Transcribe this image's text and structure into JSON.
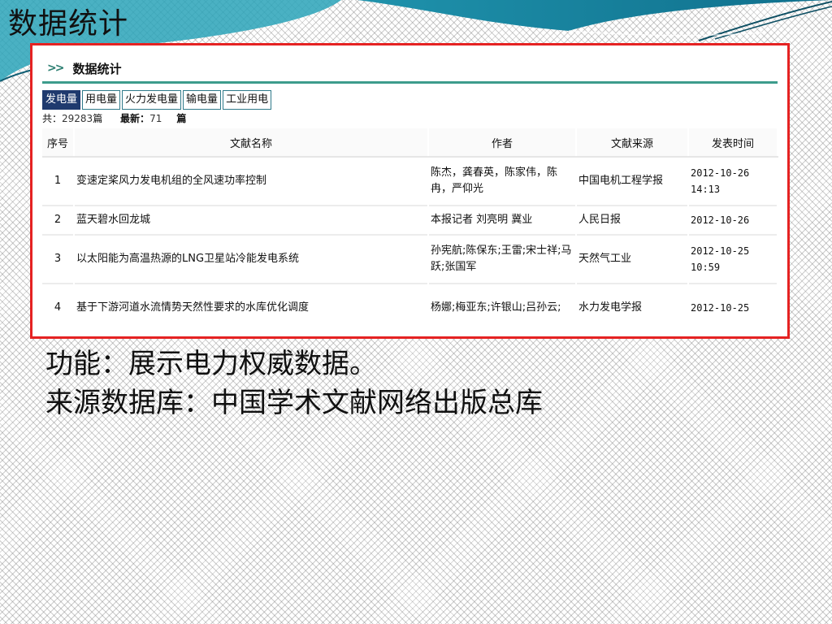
{
  "slide": {
    "title": "数据统计",
    "caption_function": "功能：展示电力权威数据。",
    "caption_source": "来源数据库：中国学术文献网络出版总库"
  },
  "panel": {
    "chevron": ">>",
    "title": "数据统计"
  },
  "tabs": [
    {
      "label": "发电量",
      "active": true
    },
    {
      "label": "用电量",
      "active": false
    },
    {
      "label": "火力发电量",
      "active": false
    },
    {
      "label": "输电量",
      "active": false
    },
    {
      "label": "工业用电",
      "active": false
    }
  ],
  "counts": {
    "total_label": "共：",
    "total_value": "29283",
    "total_unit": "篇",
    "latest_label": "最新：",
    "latest_value": "71",
    "latest_unit": "篇"
  },
  "table": {
    "headers": [
      "序号",
      "文献名称",
      "作者",
      "文献来源",
      "发表时间"
    ],
    "rows": [
      {
        "no": "1",
        "title": "变速定桨风力发电机组的全风速功率控制",
        "author": "陈杰，龚春英，陈家伟，陈冉，严仰光",
        "source": "中国电机工程学报",
        "date": "2012-10-26 14:13"
      },
      {
        "no": "2",
        "title": "蓝天碧水回龙城",
        "author": "本报记者 刘亮明 冀业",
        "source": "人民日报",
        "date": "2012-10-26"
      },
      {
        "no": "3",
        "title": "以太阳能为高温热源的LNG卫星站冷能发电系统",
        "author": "孙宪航;陈保东;王雷;宋士祥;马跃;张国军",
        "source": "天然气工业",
        "date": "2012-10-25 10:59"
      },
      {
        "no": "4",
        "title": "基于下游河道水流情势天然性要求的水库优化调度",
        "author": "杨娜;梅亚东;许银山;吕孙云;",
        "source": "水力发电学报",
        "date": "2012-10-25"
      }
    ]
  },
  "colors": {
    "frame_border": "#e52222",
    "panel_rule": "#3d9c8c",
    "tab_active_bg": "#1f3a6e",
    "header_teal": "#1f8fa8"
  }
}
